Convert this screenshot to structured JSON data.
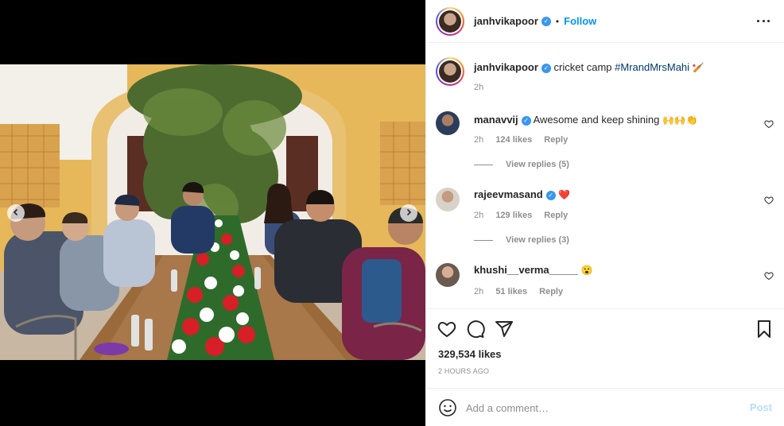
{
  "post": {
    "author": "janhvikapoor",
    "follow_label": "Follow",
    "dot": "•",
    "caption": {
      "author": "janhvikapoor",
      "text": "cricket camp",
      "hashtag": "#MrandMrsMahi",
      "emoji": "🏏",
      "time": "2h"
    }
  },
  "comments": [
    {
      "author": "manavvij",
      "text": "Awesome and keep shining",
      "emoji": "🙌🙌👏",
      "time": "2h",
      "likes": "124 likes",
      "reply": "Reply",
      "view_replies": "View replies (5)"
    },
    {
      "author": "rajeevmasand",
      "text": "",
      "emoji": "❤️",
      "time": "2h",
      "likes": "129 likes",
      "reply": "Reply",
      "view_replies": "View replies (3)"
    },
    {
      "author": "khushi__verma_____",
      "text": "",
      "emoji": "😮",
      "time": "2h",
      "likes": "51 likes",
      "reply": "Reply"
    }
  ],
  "stats": {
    "likes": "329,534 likes",
    "time_ago": "2 HOURS AGO"
  },
  "comment_box": {
    "placeholder": "Add a comment…",
    "post_label": "Post"
  },
  "colors": {
    "accent": "#0095f6",
    "heart": "#ed4956",
    "verified": "#3897f0"
  },
  "icons": [
    "more-icon",
    "heart-icon",
    "comment-icon",
    "share-icon",
    "bookmark-icon",
    "emoji-icon",
    "chevron-left-icon",
    "chevron-right-icon"
  ]
}
